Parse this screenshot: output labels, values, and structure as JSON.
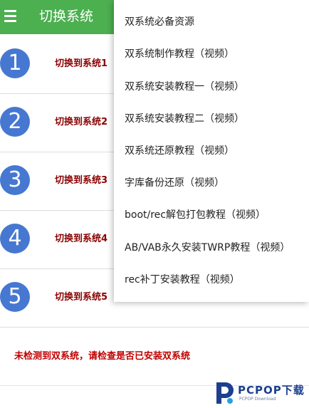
{
  "appbar": {
    "title": "切换系统",
    "menu_icon": "hamburger-menu-icon",
    "color": "#4caf50"
  },
  "systems": [
    {
      "number": "1",
      "label": "切换到系统1"
    },
    {
      "number": "2",
      "label": "切换到系统2"
    },
    {
      "number": "3",
      "label": "切换到系统3"
    },
    {
      "number": "4",
      "label": "切换到系统4"
    },
    {
      "number": "5",
      "label": "切换到系统5"
    }
  ],
  "status_message": "未检测到双系统，请检查是否已安装双系统",
  "dropdown_menu": {
    "items": [
      "双系统必备资源",
      "双系统制作教程（视频）",
      "双系统安装教程一（视频）",
      "双系统安装教程二（视频）",
      "双系统还原教程（视频）",
      "字库备份还原（视频）",
      "boot/rec解包打包教程（视频）",
      "AB/VAB永久安装TWRP教程（视频）",
      "rec补丁安装教程（视频）"
    ]
  },
  "watermark": {
    "brand": "PCPOP下载",
    "sub": "PCPOP Download"
  },
  "colors": {
    "circle": "#4678d2",
    "row_label": "#8b0000",
    "status": "#c00000"
  }
}
